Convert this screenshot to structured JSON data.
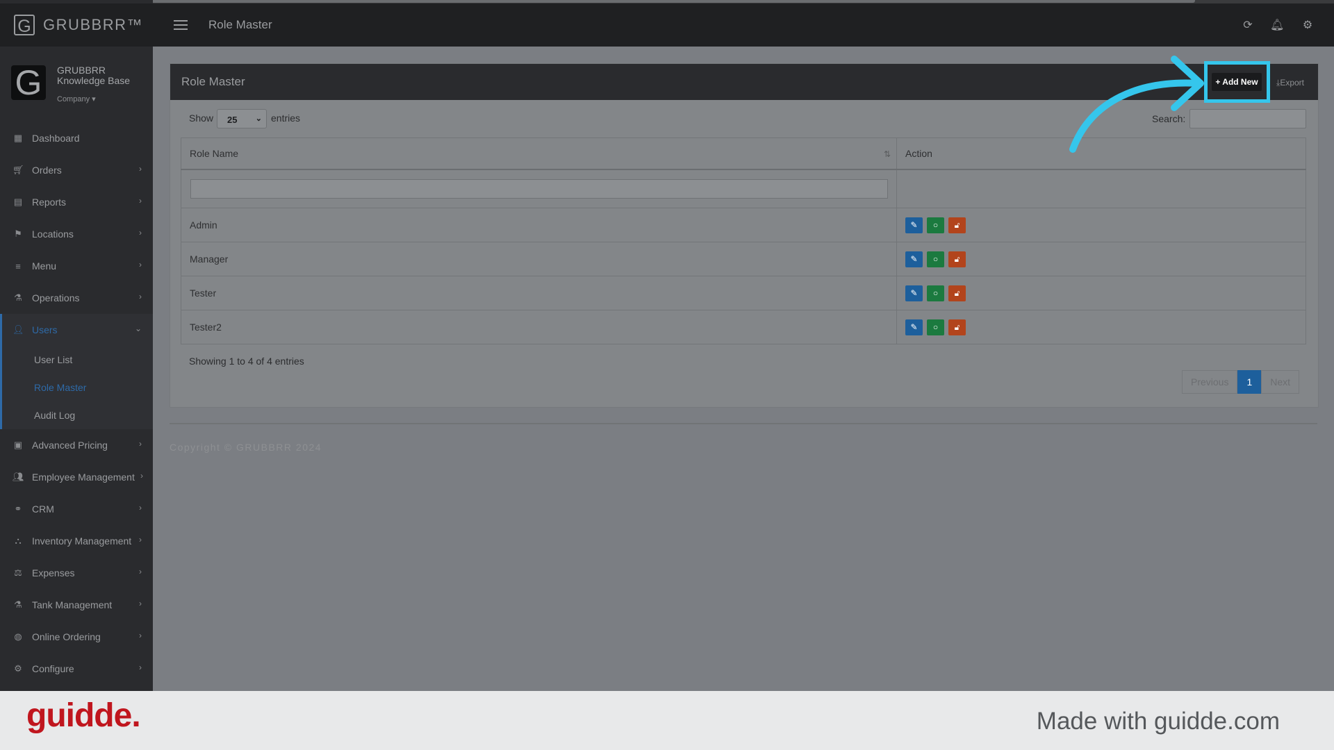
{
  "brand": {
    "logo_letter": "G",
    "name": "GRUBBRR™"
  },
  "topbar": {
    "title": "Role Master",
    "icons": [
      "refresh-icon",
      "bell-icon",
      "gear-icon"
    ]
  },
  "profile": {
    "avatar_letter": "G",
    "name": "GRUBBRR Knowledge Base",
    "company": "Company"
  },
  "sidebar": {
    "items": [
      {
        "label": "Dashboard",
        "icon": "dashboard-icon"
      },
      {
        "label": "Orders",
        "icon": "cart-icon"
      },
      {
        "label": "Reports",
        "icon": "report-icon"
      },
      {
        "label": "Locations",
        "icon": "locations-icon"
      },
      {
        "label": "Menu",
        "icon": "menu-icon"
      },
      {
        "label": "Operations",
        "icon": "flask-icon"
      },
      {
        "label": "Users",
        "icon": "user-plus-icon"
      },
      {
        "label": "Advanced Pricing",
        "icon": "money-icon"
      },
      {
        "label": "Employee Management",
        "icon": "users-icon"
      },
      {
        "label": "CRM",
        "icon": "link-icon"
      },
      {
        "label": "Inventory Management",
        "icon": "sitemap-icon"
      },
      {
        "label": "Expenses",
        "icon": "balance-icon"
      },
      {
        "label": "Tank Management",
        "icon": "flask-icon"
      },
      {
        "label": "Online Ordering",
        "icon": "globe-icon"
      },
      {
        "label": "Configure",
        "icon": "gear-icon"
      }
    ],
    "users_submenu": [
      "User List",
      "Role Master",
      "Audit Log"
    ]
  },
  "panel": {
    "title": "Role Master",
    "add_new": "+ Add New",
    "export": "Export",
    "show": "Show",
    "page_size": "25",
    "entries": "entries",
    "search_label": "Search:"
  },
  "table": {
    "headers": [
      "Role Name",
      "Action"
    ],
    "rows": [
      "Admin",
      "Manager",
      "Tester",
      "Tester2"
    ]
  },
  "info": "Showing 1 to 4 of 4 entries",
  "pagination": {
    "previous": "Previous",
    "current": "1",
    "next": "Next"
  },
  "copyright": "Copyright © GRUBBRR 2024",
  "footer": {
    "logo": "guidde.",
    "made_with": "Made with guidde.com"
  },
  "colors": {
    "highlight": "#35c6ec",
    "primary": "#1d5f9c",
    "success": "#1b7a3f",
    "danger": "#b2441c",
    "guidde_red": "#c0161e"
  }
}
